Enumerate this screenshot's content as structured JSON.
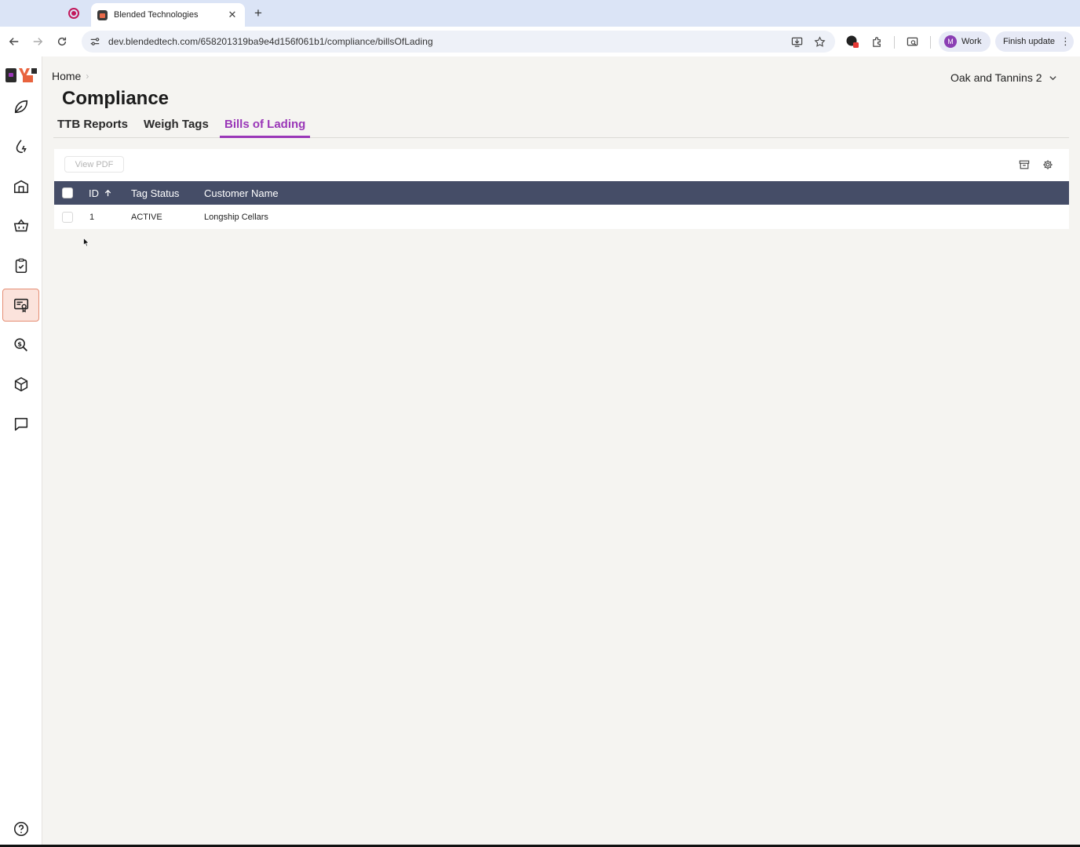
{
  "browser": {
    "tab_title": "Blended Technologies",
    "tab_close": "✕",
    "new_tab": "+",
    "url": "dev.blendedtech.com/658201319ba9e4d156f061b1/compliance/billsOfLading",
    "profile_initial": "M",
    "profile_label": "Work",
    "update_label": "Finish update",
    "accent_color": "#8b3fb4"
  },
  "sidebar": {
    "items": [
      {
        "icon": "leaf-icon",
        "active": false
      },
      {
        "icon": "drop-bolt-icon",
        "active": false
      },
      {
        "icon": "winery-building-icon",
        "active": false
      },
      {
        "icon": "basket-icon",
        "active": false
      },
      {
        "icon": "clipboard-check-icon",
        "active": false
      },
      {
        "icon": "certificate-icon",
        "active": true
      },
      {
        "icon": "money-search-icon",
        "active": false
      },
      {
        "icon": "package-box-icon",
        "active": false
      },
      {
        "icon": "chat-icon",
        "active": false
      }
    ],
    "help_icon": "help-circle-icon",
    "active_bg": "#fbe3dc"
  },
  "header": {
    "breadcrumb_home": "Home",
    "title": "Compliance",
    "org_name": "Oak and Tannins 2"
  },
  "tabs": [
    {
      "label": "TTB Reports",
      "active": false
    },
    {
      "label": "Weigh Tags",
      "active": false
    },
    {
      "label": "Bills of Lading",
      "active": true
    }
  ],
  "table": {
    "view_pdf_label": "View PDF",
    "columns": [
      "ID",
      "Tag Status",
      "Customer Name"
    ],
    "sort": {
      "column": "ID",
      "direction": "ascending"
    },
    "rows": [
      {
        "id": "1",
        "tag_status": "ACTIVE",
        "customer_name": "Longship Cellars"
      }
    ],
    "header_color": "#454d67",
    "active_tab_color": "#9a37b8"
  }
}
